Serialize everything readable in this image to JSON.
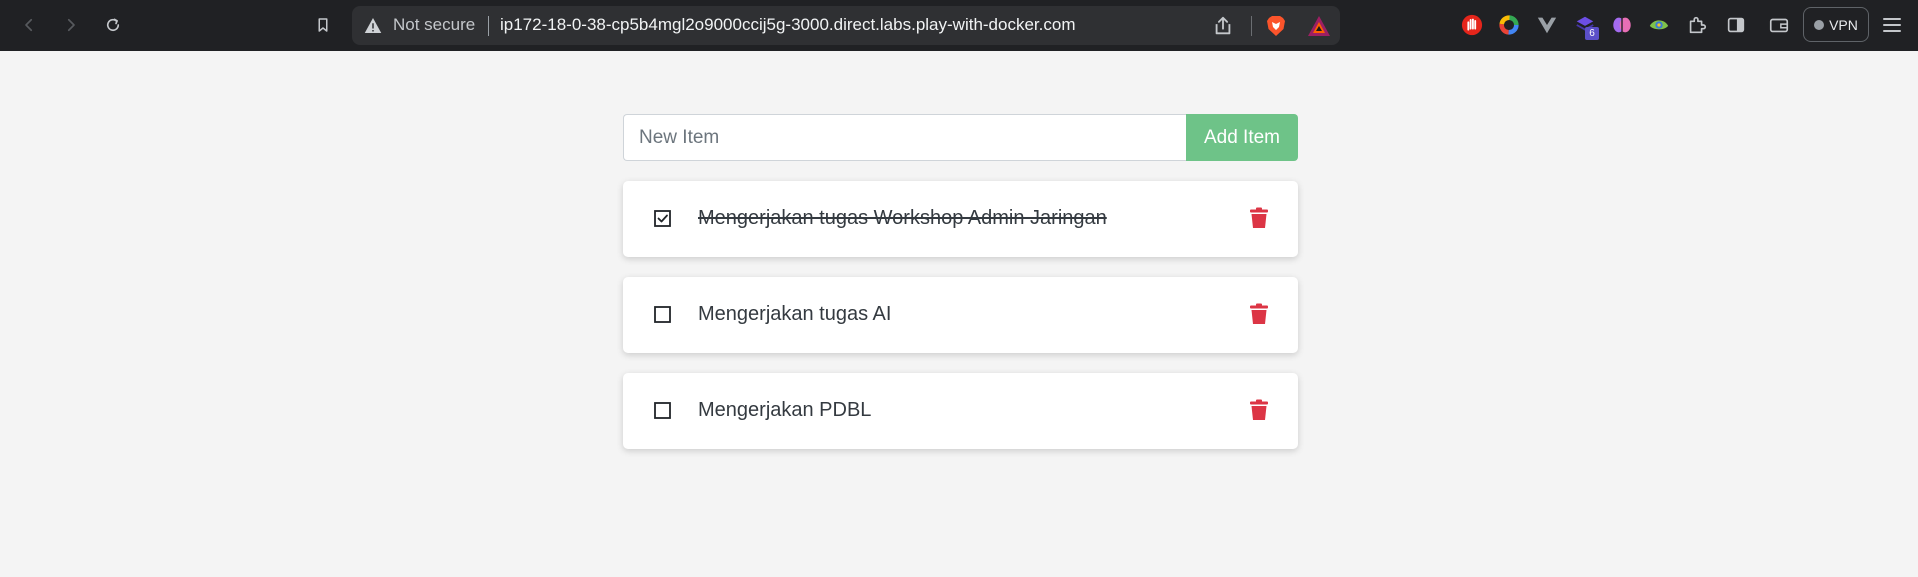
{
  "browser": {
    "security_label": "Not secure",
    "url": "ip172-18-0-38-cp5b4mgl2o9000ccij5g-3000.direct.labs.play-with-docker.com",
    "extension_badge": "6",
    "vpn_label": "VPN"
  },
  "form": {
    "placeholder": "New Item",
    "add_label": "Add Item",
    "add_color": "#6ec388"
  },
  "items": [
    {
      "label": "Mengerjakan tugas Workshop Admin Jaringan",
      "completed": true
    },
    {
      "label": "Mengerjakan tugas AI",
      "completed": false
    },
    {
      "label": "Mengerjakan PDBL",
      "completed": false
    }
  ],
  "colors": {
    "delete": "#dc3545",
    "page_bg": "#f4f4f4"
  }
}
